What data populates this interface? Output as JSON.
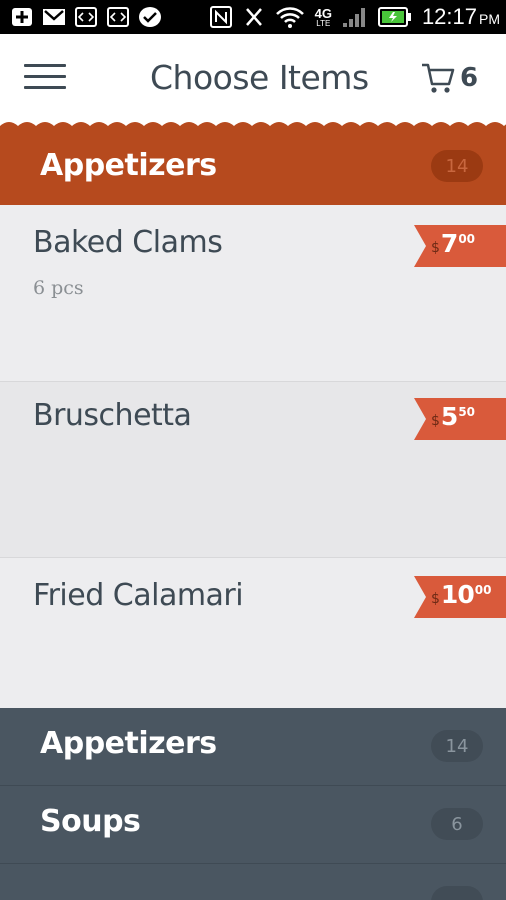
{
  "status_bar": {
    "time": "12:17",
    "ampm": "PM",
    "network": "4G",
    "network_sub": "LTE"
  },
  "header": {
    "title": "Choose Items",
    "cart_count": "6"
  },
  "section": {
    "title": "Appetizers",
    "count": "14"
  },
  "items": [
    {
      "name": "Baked Clams",
      "description": "6 pcs",
      "currency": "$",
      "price_int": "7",
      "price_cents": "00"
    },
    {
      "name": "Bruschetta",
      "description": "",
      "currency": "$",
      "price_int": "5",
      "price_cents": "50"
    },
    {
      "name": "Fried Calamari",
      "description": "",
      "currency": "$",
      "price_int": "10",
      "price_cents": "00"
    }
  ],
  "categories": [
    {
      "name": "Appetizers",
      "count": "14"
    },
    {
      "name": "Soups",
      "count": "6"
    }
  ],
  "colors": {
    "accent": "#b64a1e",
    "price_tag": "#d95a3b",
    "category_panel": "#4a5661",
    "text_dark": "#3e4a54"
  }
}
